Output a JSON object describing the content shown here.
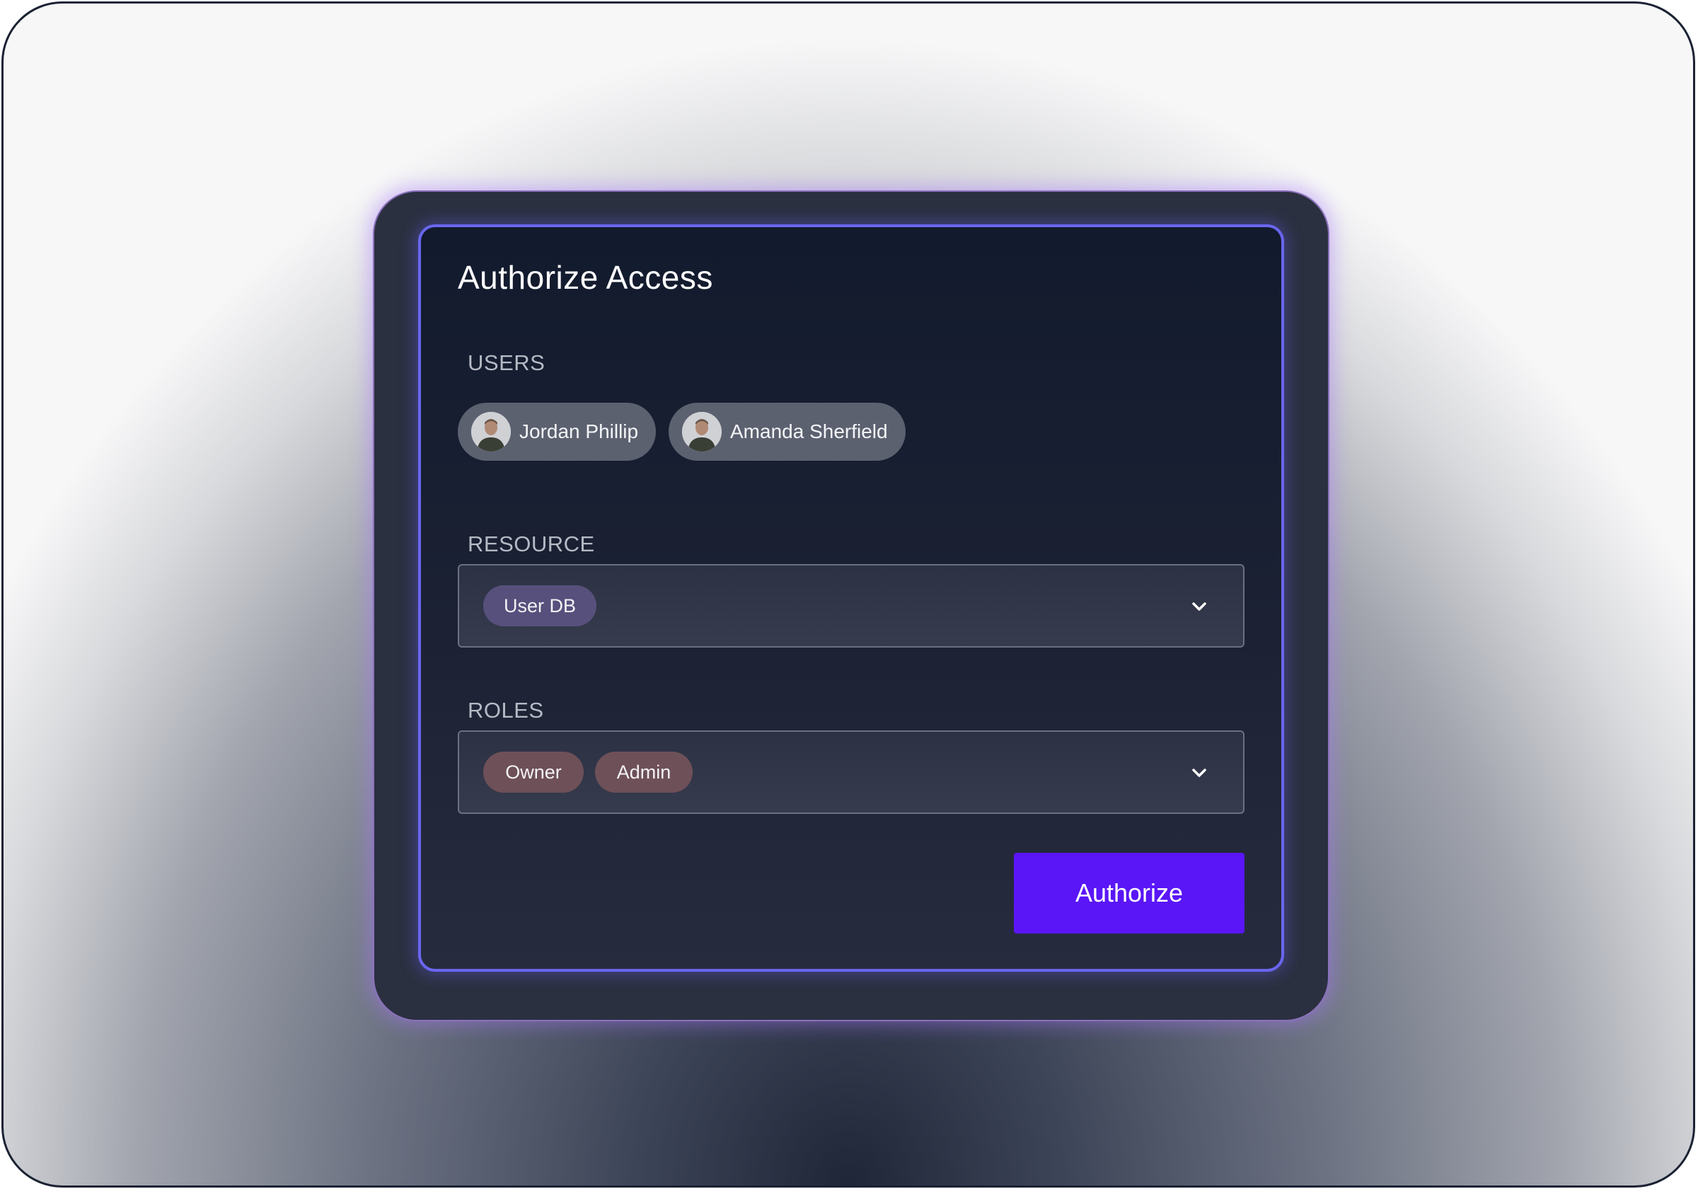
{
  "dialog": {
    "title": "Authorize Access"
  },
  "users": {
    "label": "USERS",
    "items": [
      {
        "name": "Jordan Phillip",
        "avatar_icon": "user-avatar-photo"
      },
      {
        "name": "Amanda Sherfield",
        "avatar_icon": "user-avatar-photo"
      }
    ]
  },
  "resource": {
    "label": "RESOURCE",
    "selected": [
      "User DB"
    ],
    "dropdown_icon": "chevron-down-icon"
  },
  "roles": {
    "label": "ROLES",
    "selected": [
      "Owner",
      "Admin"
    ],
    "dropdown_icon": "chevron-down-icon"
  },
  "actions": {
    "authorize_label": "Authorize"
  },
  "colors": {
    "accent": "#5a16f7",
    "panel_border": "#6a66f0",
    "glow": "#a878ff",
    "resource_tag": "#57507c",
    "role_tag": "#6e5058",
    "user_chip": "#5c6170"
  }
}
